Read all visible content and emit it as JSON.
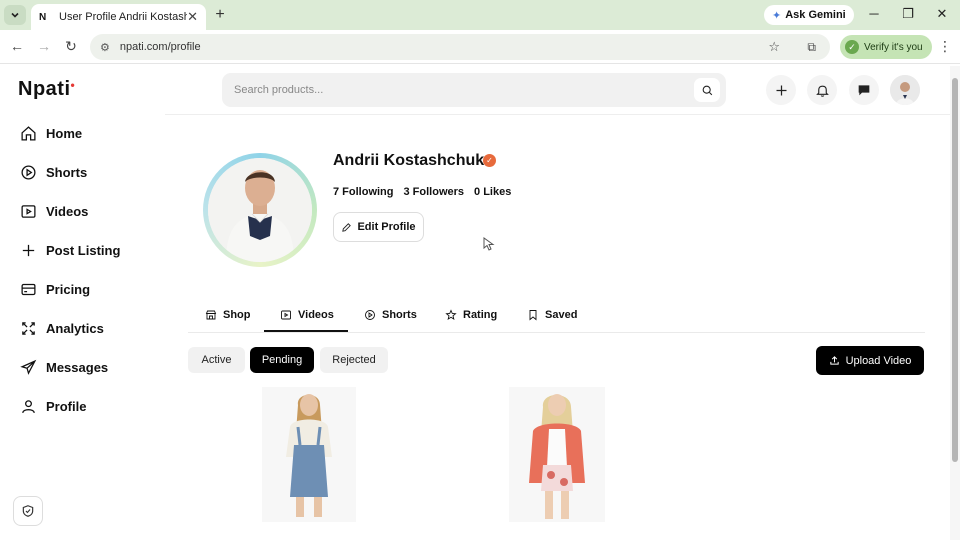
{
  "browser": {
    "tab_title": "User Profile Andrii Kostashchuk",
    "tab_favicon": "N",
    "ask_gemini": "Ask Gemini",
    "url": "npati.com/profile",
    "verify_label": "Verify it's you"
  },
  "sidebar": {
    "logo": "Npati",
    "items": [
      {
        "label": "Home",
        "icon": "home-icon"
      },
      {
        "label": "Shorts",
        "icon": "play-circle-icon"
      },
      {
        "label": "Videos",
        "icon": "video-icon"
      },
      {
        "label": "Post Listing",
        "icon": "plus-icon"
      },
      {
        "label": "Pricing",
        "icon": "credit-card-icon"
      },
      {
        "label": "Analytics",
        "icon": "analytics-icon"
      },
      {
        "label": "Messages",
        "icon": "send-icon"
      },
      {
        "label": "Profile",
        "icon": "user-icon"
      }
    ]
  },
  "header": {
    "search_placeholder": "Search products..."
  },
  "profile": {
    "name": "Andrii Kostashchuk",
    "following": "7 Following",
    "followers": "3 Followers",
    "likes": "0 Likes",
    "edit_label": "Edit Profile"
  },
  "tabs": [
    {
      "label": "Shop",
      "icon": "store-icon"
    },
    {
      "label": "Videos",
      "icon": "video-icon"
    },
    {
      "label": "Shorts",
      "icon": "play-circle-icon"
    },
    {
      "label": "Rating",
      "icon": "star-icon"
    },
    {
      "label": "Saved",
      "icon": "bookmark-icon"
    }
  ],
  "active_tab": "Videos",
  "filters": [
    "Active",
    "Pending",
    "Rejected"
  ],
  "active_filter": "Pending",
  "upload_label": "Upload Video",
  "colors": {
    "accent": "#000000",
    "verified_badge": "#e76a3c",
    "logo_dot": "#e53935",
    "tabbar_bg": "#dcebd6"
  }
}
